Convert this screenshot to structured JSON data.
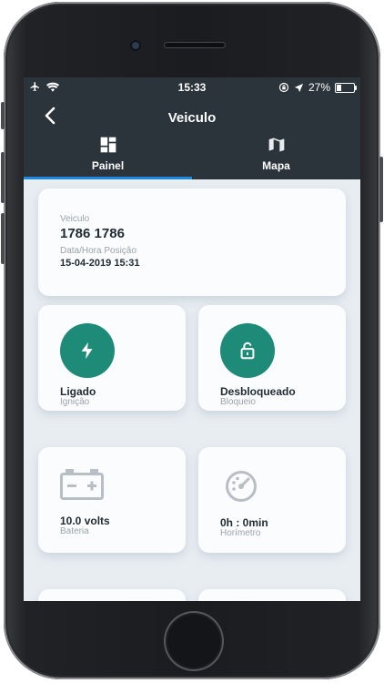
{
  "status_bar": {
    "time": "15:33",
    "battery_percent": "27%",
    "battery_level": 0.27,
    "icons": [
      "airplane-icon",
      "wifi-icon",
      "screen-lock-icon",
      "location-arrow-icon",
      "battery-icon"
    ]
  },
  "nav": {
    "title": "Veiculo",
    "tabs": [
      {
        "label": "Painel",
        "icon": "dashboard-grid-icon",
        "active": true
      },
      {
        "label": "Mapa",
        "icon": "map-icon",
        "active": false
      }
    ]
  },
  "vehicle_card": {
    "vehicle_label": "Veiculo",
    "vehicle_value": "1786 1786",
    "datetime_label": "Data/Hora Posição",
    "datetime_value": "15-04-2019 15:31"
  },
  "tiles": [
    {
      "value": "Ligado",
      "label": "Ignição",
      "icon": "bolt-icon"
    },
    {
      "value": "Desbloqueado",
      "label": "Bloqueio",
      "icon": "unlock-icon"
    },
    {
      "value": "10.0 volts",
      "label": "Bateria",
      "icon": "car-battery-icon"
    },
    {
      "value": "0h : 0min",
      "label": "Horímetro",
      "icon": "gauge-icon"
    }
  ],
  "colors": {
    "nav_bg": "#2b343b",
    "tab_indicator": "#1e88e5",
    "status_teal": "#1e8a78",
    "icon_gray": "#b7bec5"
  }
}
